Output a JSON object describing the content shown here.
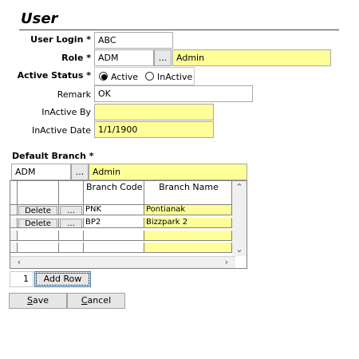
{
  "title": "User",
  "form": {
    "user_login_label": "User Login *",
    "user_login_value": "ABC",
    "role_label": "Role *",
    "role_code": "ADM",
    "role_lookup_button": "...",
    "role_name": "Admin",
    "active_status_label": "Active Status *",
    "active_option": "Active",
    "inactive_option": "InActive",
    "remark_label": "Remark",
    "remark_value": "OK",
    "inactive_by_label": "InActive By",
    "inactive_by_value": "",
    "inactive_date_label": "InActive Date",
    "inactive_date_value": "1/1/1900"
  },
  "default_branch": {
    "label": "Default Branch *",
    "code": "ADM",
    "lookup_button": "...",
    "name": "Admin"
  },
  "grid": {
    "columns": [
      "",
      "",
      "Branch Code",
      "Branch Name"
    ],
    "rows": [
      {
        "delete": "Delete",
        "lookup": "...",
        "code": "PNK",
        "name": "Pontianak"
      },
      {
        "delete": "Delete",
        "lookup": "...",
        "code": "BP2",
        "name": "Bizzpark 2"
      }
    ],
    "row_count": "1",
    "add_row_label": "Add Row"
  },
  "buttons": {
    "save_first": "S",
    "save_rest": "ave",
    "cancel_first": "C",
    "cancel_rest": "ancel"
  },
  "colors": {
    "readonly_yellow": "#ffff99"
  }
}
